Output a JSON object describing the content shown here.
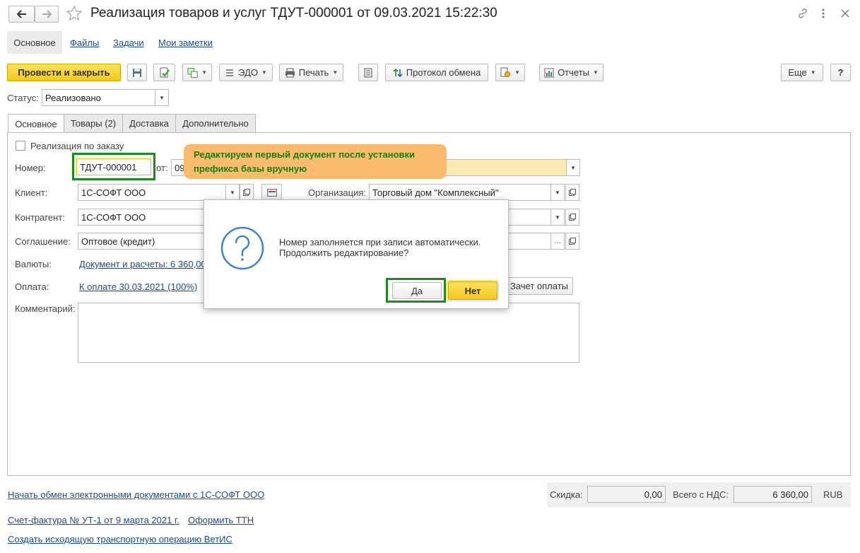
{
  "window": {
    "title": "Реализация товаров и услуг ТДУТ-000001 от 09.03.2021 15:22:30"
  },
  "nav_tabs": [
    "Основное",
    "Файлы",
    "Задачи",
    "Мои заметки"
  ],
  "toolbar": {
    "post_close": "Провести и закрыть",
    "edo": "ЭДО",
    "print": "Печать",
    "exchange_protocol": "Протокол обмена",
    "reports": "Отчеты",
    "more": "Еще",
    "help": "?"
  },
  "status": {
    "label": "Статус:",
    "value": "Реализовано"
  },
  "form_tabs": [
    "Основное",
    "Товары (2)",
    "Доставка",
    "Дополнительно"
  ],
  "form": {
    "by_order": "Реализация по заказу",
    "number_label": "Номер:",
    "number_value": "ТДУТ-000001",
    "date_label": "от:",
    "date_value": "09",
    "client_label": "Клиент:",
    "client_value": "1С-СОФТ ООО",
    "org_label": "Организация:",
    "org_value": "Торговый дом \"Комплексный\"",
    "counterparty_label": "Контрагент:",
    "counterparty_value": "1С-СОФТ ООО",
    "agreement_label": "Соглашение:",
    "agreement_value": "Оптовое (кредит)",
    "currency_label": "Валюты:",
    "currency_link": "Документ и расчеты: 6 360,00",
    "payment_label": "Оплата:",
    "payment_link": "К оплате 30.03.2021 (100%)",
    "payment_offset": "Зачет оплаты",
    "comment_label": "Комментарий:"
  },
  "callout": {
    "text": "Редактируем первый документ после установки префикса базы вручную"
  },
  "dialog": {
    "message_line1": "Номер заполняется при записи автоматически.",
    "message_line2": "Продолжить редактирование?",
    "yes": "Да",
    "no": "Нет"
  },
  "footer": {
    "edo_link": "Начать обмен электронными документами с 1С-СОФТ ООО",
    "discount_label": "Скидка:",
    "discount_value": "0,00",
    "total_label": "Всего с НДС:",
    "total_value": "6 360,00",
    "currency": "RUB",
    "invoice_link": "Счет-фактура № УТ-1 от 9 марта 2021 г.",
    "ttn_link": "Оформить ТТН",
    "vetis_link": "Создать исходящую транспортную операцию ВетИС"
  },
  "colors": {
    "primary_button": "#f7d33a",
    "callout_bg": "#fbbb6e",
    "callout_text": "#1e7a12",
    "highlight_border": "#1e8a1e",
    "link": "#1b4a8c"
  }
}
